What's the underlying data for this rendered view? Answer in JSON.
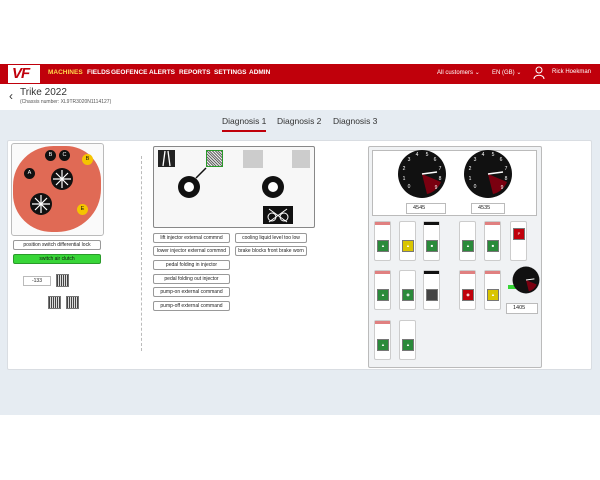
{
  "brand": {
    "logo_text": "VF"
  },
  "nav": {
    "items": [
      "MACHINES",
      "FIELDS",
      "GEOFENCE",
      "ALERTS",
      "REPORTS",
      "SETTINGS",
      "ADMIN"
    ],
    "customer_select": "All customers",
    "language_select": "EN (GB)",
    "user_name": "Rick Hoekman",
    "accent_color": "#c0000b"
  },
  "header": {
    "back_icon": "chevron-left-icon",
    "title": "Trike 2022",
    "chassis": "(Chassis number: XL9TR3020N1114127)"
  },
  "tabs": [
    "Diagnosis 1",
    "Diagnosis 2",
    "Diagnosis 3"
  ],
  "active_tab": "Diagnosis 1",
  "joystick": {
    "buttons": [
      "B",
      "C",
      "B",
      "A",
      "E"
    ],
    "labels": {
      "position_switch": "position switch differential lock",
      "air_clutch": "switch air clutch"
    },
    "value": "-133"
  },
  "commands": {
    "left": [
      "lift injector external commnd",
      "lower injector external commnd",
      "pedal folding in injector",
      "pedal folding out injector",
      "pump-on external command",
      "pump-off external command"
    ],
    "right": [
      "cooling liquid level too low",
      "brake blocks front brake worn"
    ]
  },
  "gauges": {
    "tick_labels": [
      "0",
      "1",
      "2",
      "3",
      "4",
      "5",
      "6",
      "7",
      "8",
      "9",
      "10"
    ],
    "gauge1_value": "4545",
    "gauge2_value": "4535",
    "gauge3_value": "1405",
    "gauge_fill_color": "#7a0010"
  },
  "switch_icons": [
    "cruise-control-icon",
    "seat-icon",
    "diff-lock-icon",
    "hydraulics-icon",
    "valve-icon",
    "parking-brake-icon",
    "rpm-icon",
    "circle-arrows-icon",
    "square-icon",
    "horn-icon",
    "seat-icon",
    "rpm-icon",
    "lift-icon"
  ]
}
